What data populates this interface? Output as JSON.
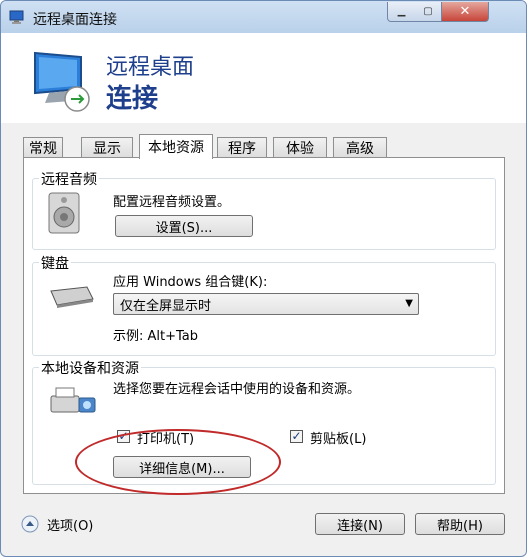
{
  "window": {
    "title": "远程桌面连接",
    "close_glyph": "✕",
    "min_glyph": "▁",
    "max_glyph": "▢"
  },
  "header": {
    "line1": "远程桌面",
    "line2": "连接"
  },
  "tabs": [
    {
      "label": "常规",
      "active": false
    },
    {
      "label": "显示",
      "active": false
    },
    {
      "label": "本地资源",
      "active": true
    },
    {
      "label": "程序",
      "active": false
    },
    {
      "label": "体验",
      "active": false
    },
    {
      "label": "高级",
      "active": false
    }
  ],
  "audio": {
    "group_label": "远程音频",
    "description": "配置远程音频设置。",
    "settings_button": "设置(S)..."
  },
  "keyboard": {
    "group_label": "键盘",
    "description": "应用 Windows 组合键(K):",
    "selected_option": "仅在全屏显示时",
    "example": "示例: Alt+Tab"
  },
  "devices": {
    "group_label": "本地设备和资源",
    "description": "选择您要在远程会话中使用的设备和资源。",
    "printer_label": "打印机(T)",
    "clipboard_label": "剪贴板(L)",
    "printer_checked": true,
    "clipboard_checked": true,
    "check_glyph": "✓",
    "details_button": "详细信息(M)..."
  },
  "footer": {
    "options_label": "选项(O)",
    "connect_button": "连接(N)",
    "help_button": "帮助(H)"
  },
  "colors": {
    "title_blue": "#1e3f8c",
    "annotation_red": "#c12a2a"
  }
}
